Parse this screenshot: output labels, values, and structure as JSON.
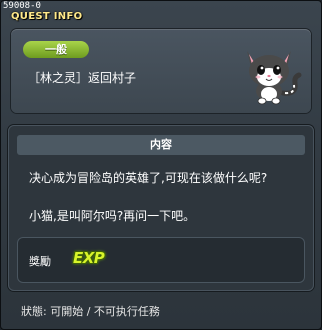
{
  "window": {
    "quest_id": "59008-0",
    "title": "QUEST INFO"
  },
  "quest": {
    "category": "一般",
    "name": "［林之灵］返回村子",
    "npc_icon": "cat-npc-icon"
  },
  "content": {
    "header": "内容",
    "description_line1": "决心成为冒险岛的英雄了,可现在该做什么呢?",
    "description_line2": "小猫,是叫阿尔吗?再问一下吧。"
  },
  "reward": {
    "label": "獎勵",
    "item_text": "EXP",
    "item_icon": "exp-icon"
  },
  "status": {
    "text": "狀態: 可開始 / 不可执行任務"
  },
  "colors": {
    "title": "#ffe98a",
    "category_badge": "#8cc236",
    "exp": "#d8f52a"
  }
}
